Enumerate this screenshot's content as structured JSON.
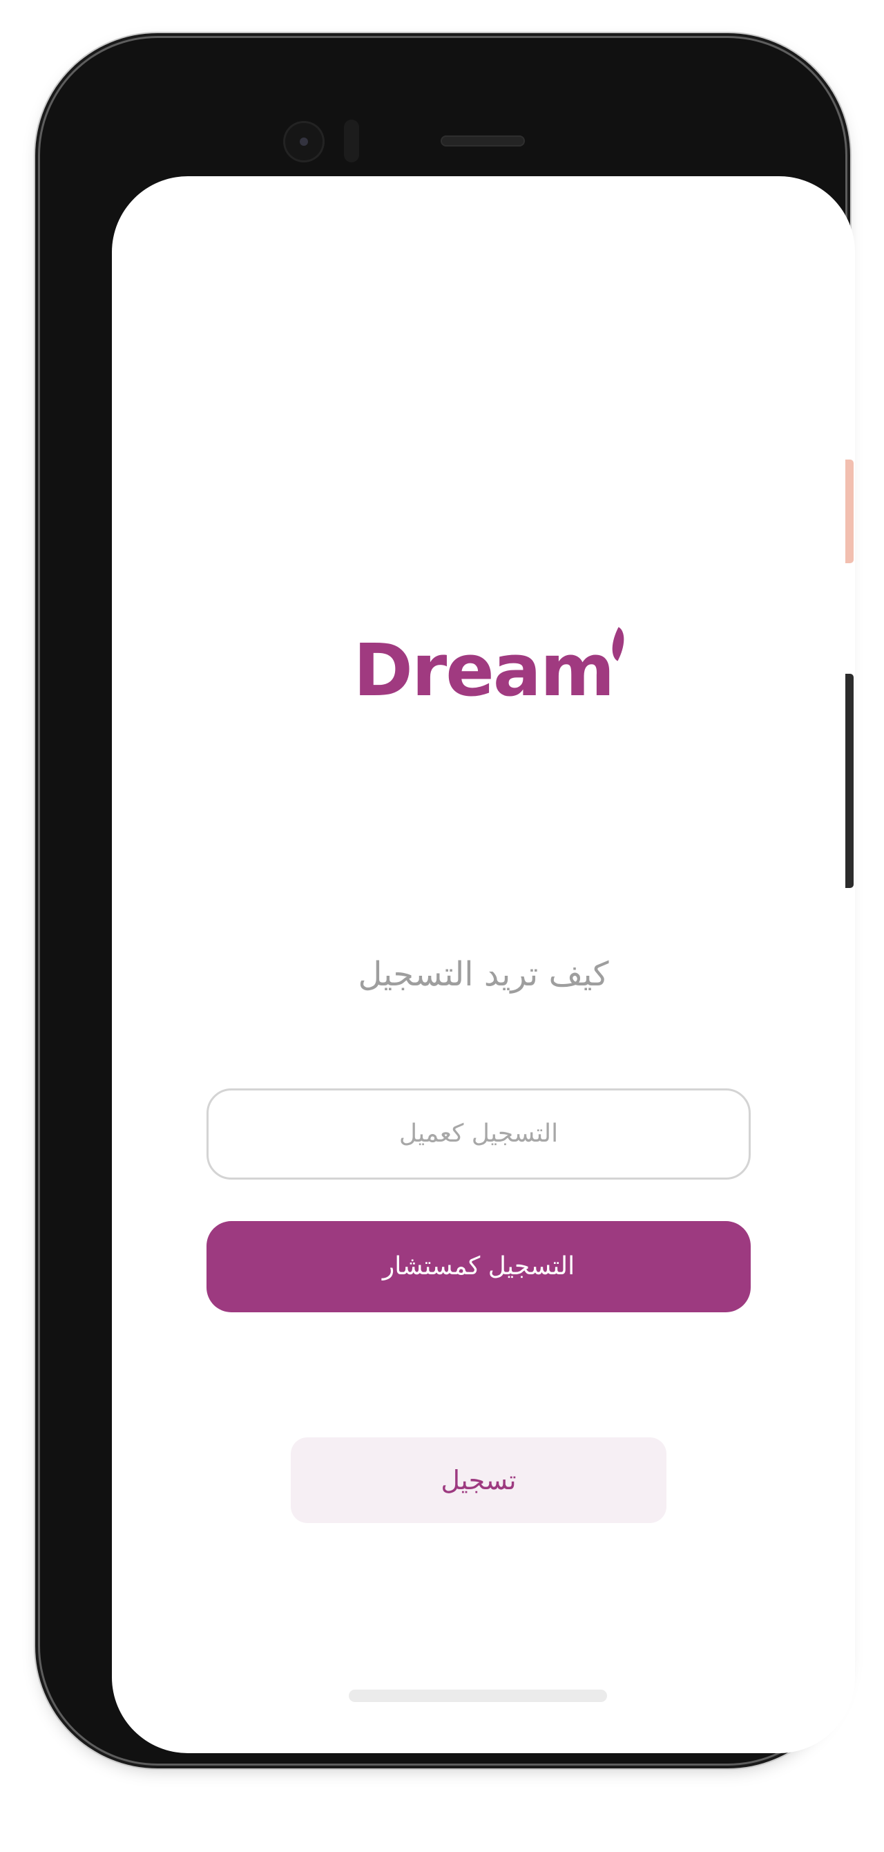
{
  "app": {
    "logo_text": "Dream",
    "brand_color": "#a03a80"
  },
  "screen": {
    "heading": "كيف تريد التسجيل",
    "client_button_label": "التسجيل كعميل",
    "consultant_button_label": "التسجيل كمستشار",
    "register_button_label": "تسجيل"
  },
  "colors": {
    "primary": "#9d3a80",
    "secondary_bg": "#f6eff4",
    "muted_text": "#9e9e9e",
    "outline": "#d4d4d4"
  },
  "icons": {
    "logo_leaf": "leaf-icon"
  }
}
